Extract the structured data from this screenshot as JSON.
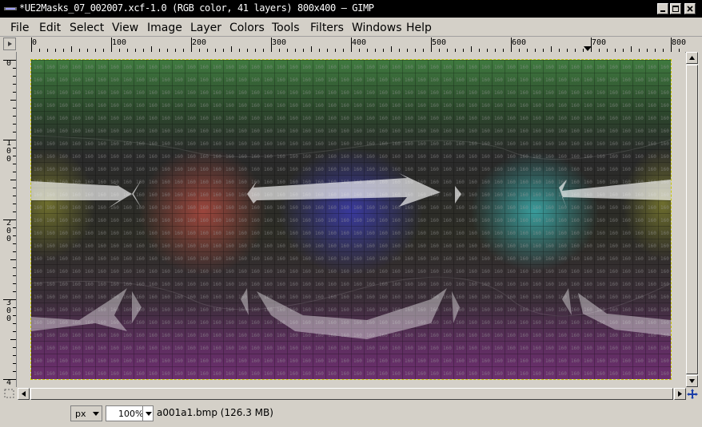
{
  "window": {
    "title": "*UE2Masks_07_002007.xcf-1.0 (RGB color, 41 layers) 800x400 – GIMP"
  },
  "menu": {
    "items": [
      "File",
      "Edit",
      "Select",
      "View",
      "Image",
      "Layer",
      "Colors",
      "Tools",
      "Filters",
      "Windows",
      "Help"
    ]
  },
  "rulers": {
    "horizontal_labels": [
      "0",
      "100",
      "200",
      "300",
      "400",
      "500",
      "600",
      "700",
      "800"
    ],
    "vertical_labels": [
      "0",
      "100",
      "200",
      "300",
      "4"
    ]
  },
  "canvas": {
    "band_colors": [
      "#3f7a3f",
      "#2d3f2d",
      "#2a2a2a",
      "#3a3c25",
      "#553d54",
      "#6b2f6d"
    ],
    "blob_colors": [
      "#b04a40",
      "#3a3aa8",
      "#3aa8a8"
    ],
    "grid_label": "160"
  },
  "statusbar": {
    "unit": "px",
    "zoom": "100%",
    "info": "a001a1.bmp (126.3 MB)"
  },
  "icons": {
    "app": "gimp-icon",
    "minimize": "minimize-icon",
    "maximize": "maximize-icon",
    "close": "close-icon",
    "navigate": "navigate-icon"
  }
}
